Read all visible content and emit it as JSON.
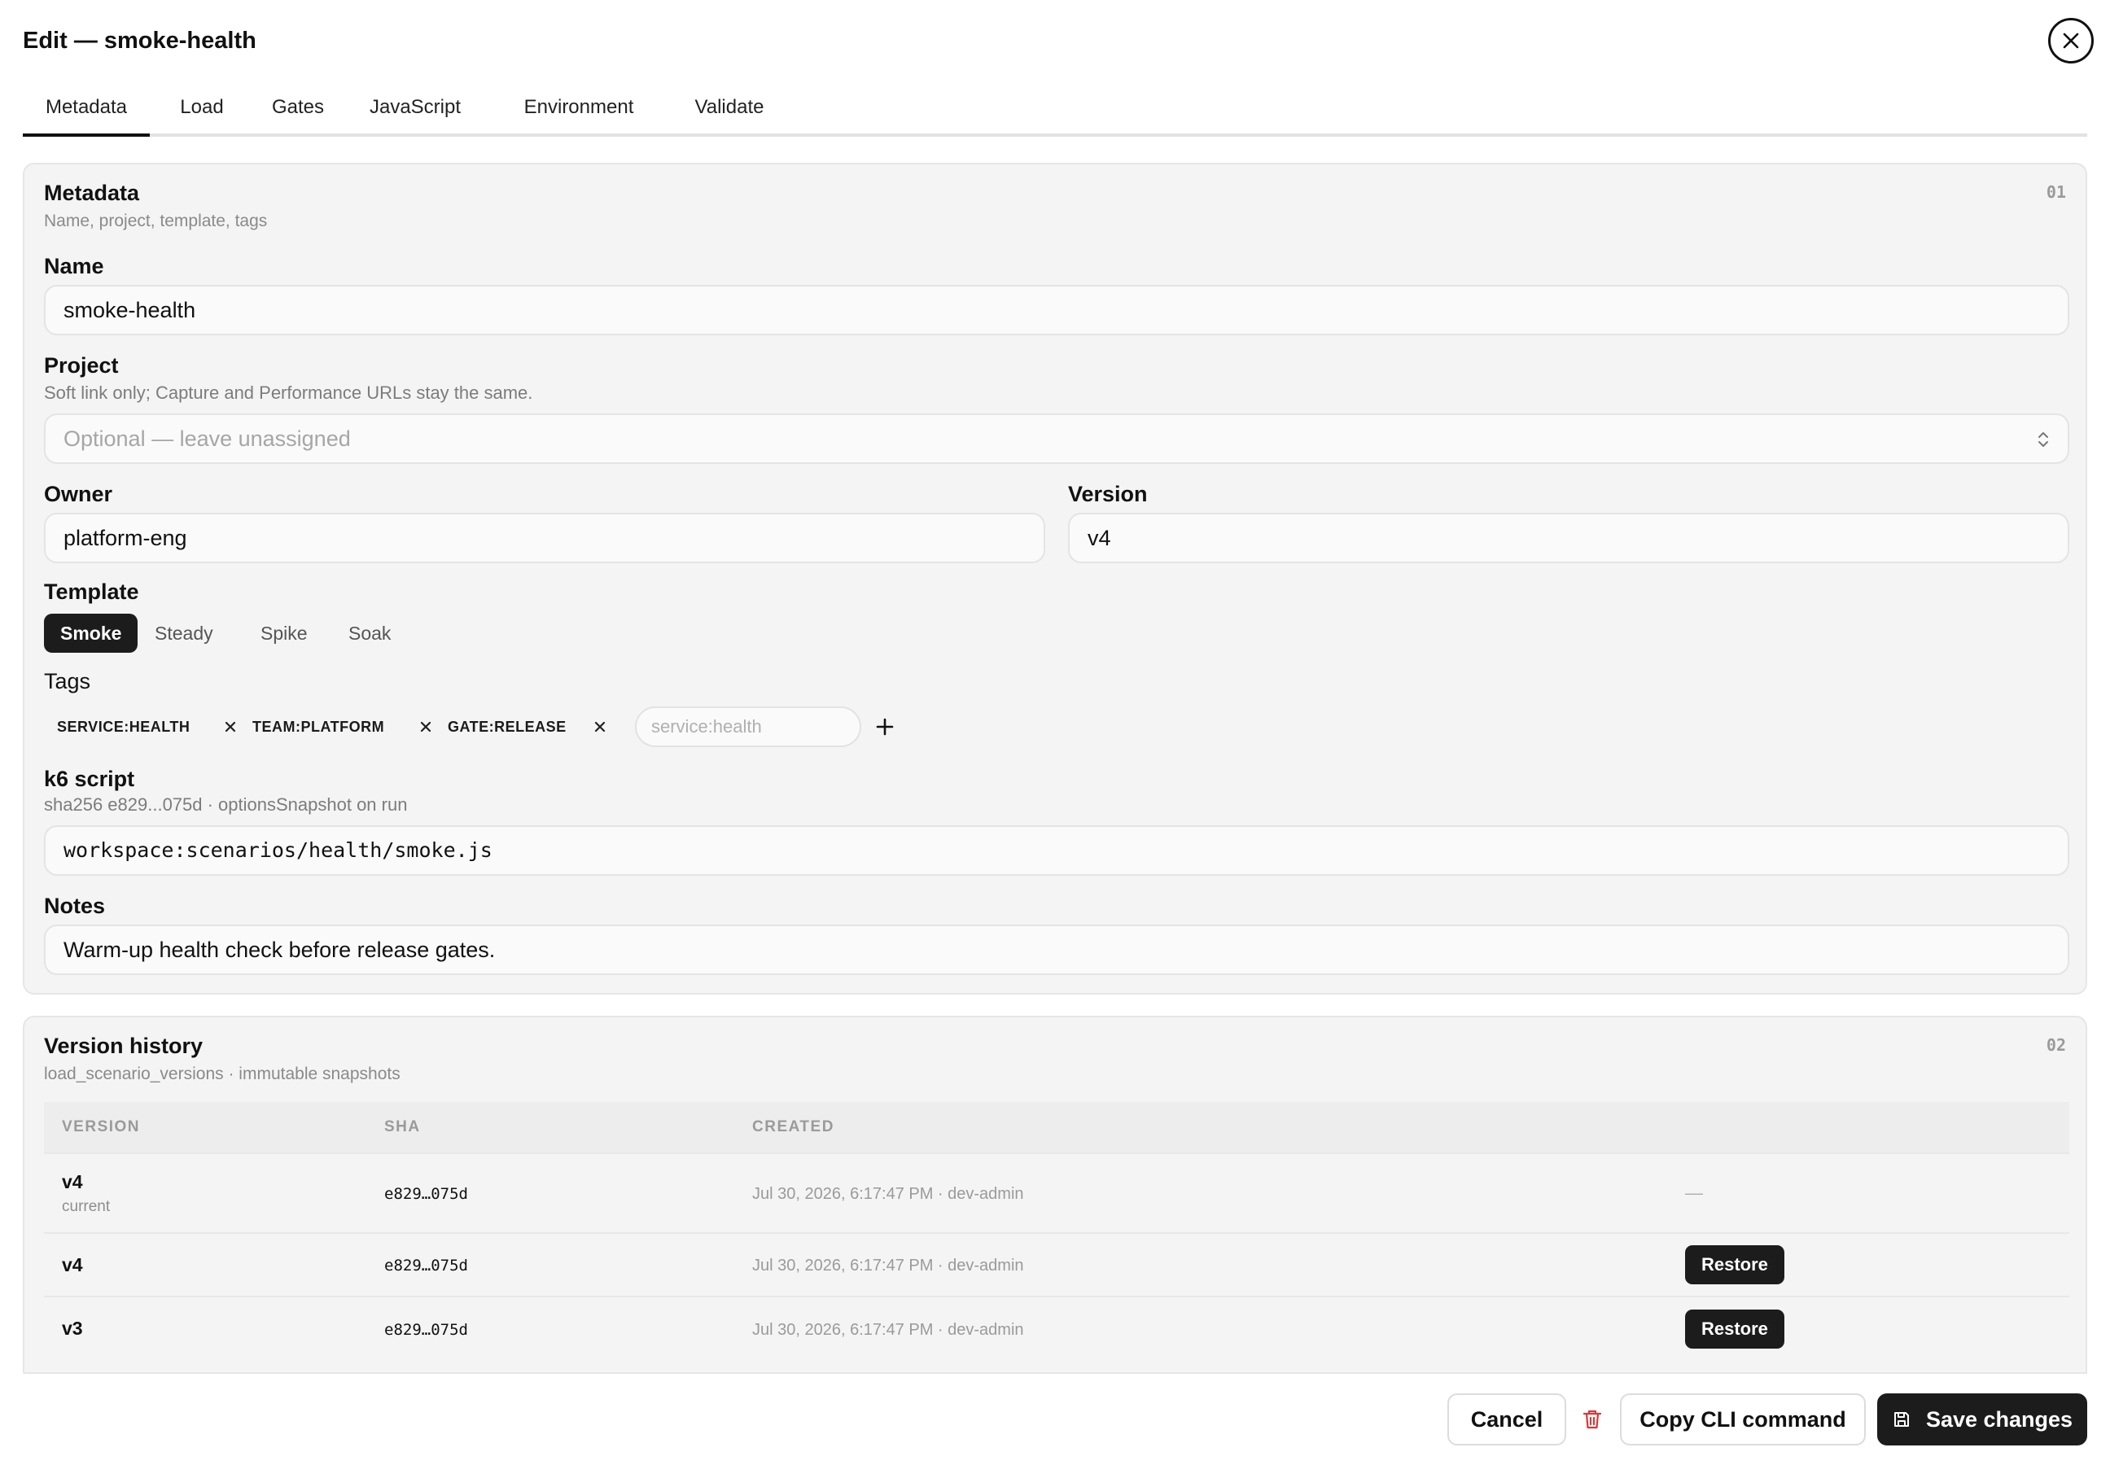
{
  "header": {
    "title": "Edit — smoke-health"
  },
  "tabs": [
    {
      "label": "Metadata"
    },
    {
      "label": "Load"
    },
    {
      "label": "Gates"
    },
    {
      "label": "JavaScript"
    },
    {
      "label": "Environment"
    },
    {
      "label": "Validate"
    }
  ],
  "metadata": {
    "title": "Metadata",
    "subtitle": "Name, project, template, tags",
    "number": "01",
    "name_label": "Name",
    "name_value": "smoke-health",
    "project_label": "Project",
    "project_hint": "Soft link only; Capture and Performance URLs stay the same.",
    "project_placeholder": "Optional — leave unassigned",
    "owner_label": "Owner",
    "owner_value": "platform-eng",
    "version_label": "Version",
    "version_value": "v4",
    "template_label": "Template",
    "templates": [
      "Smoke",
      "Steady",
      "Spike",
      "Soak"
    ],
    "template_selected": "Smoke",
    "tags_label": "Tags",
    "tags": [
      "SERVICE:HEALTH",
      "TEAM:PLATFORM",
      "GATE:RELEASE"
    ],
    "tag_placeholder": "service:health",
    "script_label": "k6 script",
    "script_hint": "sha256 e829...075d · optionsSnapshot on run",
    "script_value": "workspace:scenarios/health/smoke.js",
    "notes_label": "Notes",
    "notes_value": "Warm-up health check before release gates."
  },
  "history": {
    "title": "Version history",
    "subtitle": "load_scenario_versions · immutable snapshots",
    "number": "02",
    "columns": [
      "VERSION",
      "SHA",
      "CREATED"
    ],
    "rows": [
      {
        "version": "v4",
        "note": "current",
        "sha": "e829…075d",
        "created": "Jul 30, 2026, 6:17:47 PM · dev-admin",
        "action": "—"
      },
      {
        "version": "v4",
        "note": "",
        "sha": "e829…075d",
        "created": "Jul 30, 2026, 6:17:47 PM · dev-admin",
        "action": "Restore"
      },
      {
        "version": "v3",
        "note": "",
        "sha": "e829…075d",
        "created": "Jul 30, 2026, 6:17:47 PM · dev-admin",
        "action": "Restore"
      }
    ]
  },
  "footer": {
    "cancel": "Cancel",
    "copy_cli": "Copy CLI command",
    "save": "Save changes"
  },
  "colors": {
    "accent": "#1c1c1c",
    "danger": "#d23b3b",
    "card_bg": "#f4f4f4"
  },
  "icons": {
    "close": "close-icon",
    "select": "chevron-updown-icon",
    "tag_remove": "x-icon",
    "add_tag": "plus-icon",
    "delete": "trash-icon",
    "save": "save-icon"
  }
}
